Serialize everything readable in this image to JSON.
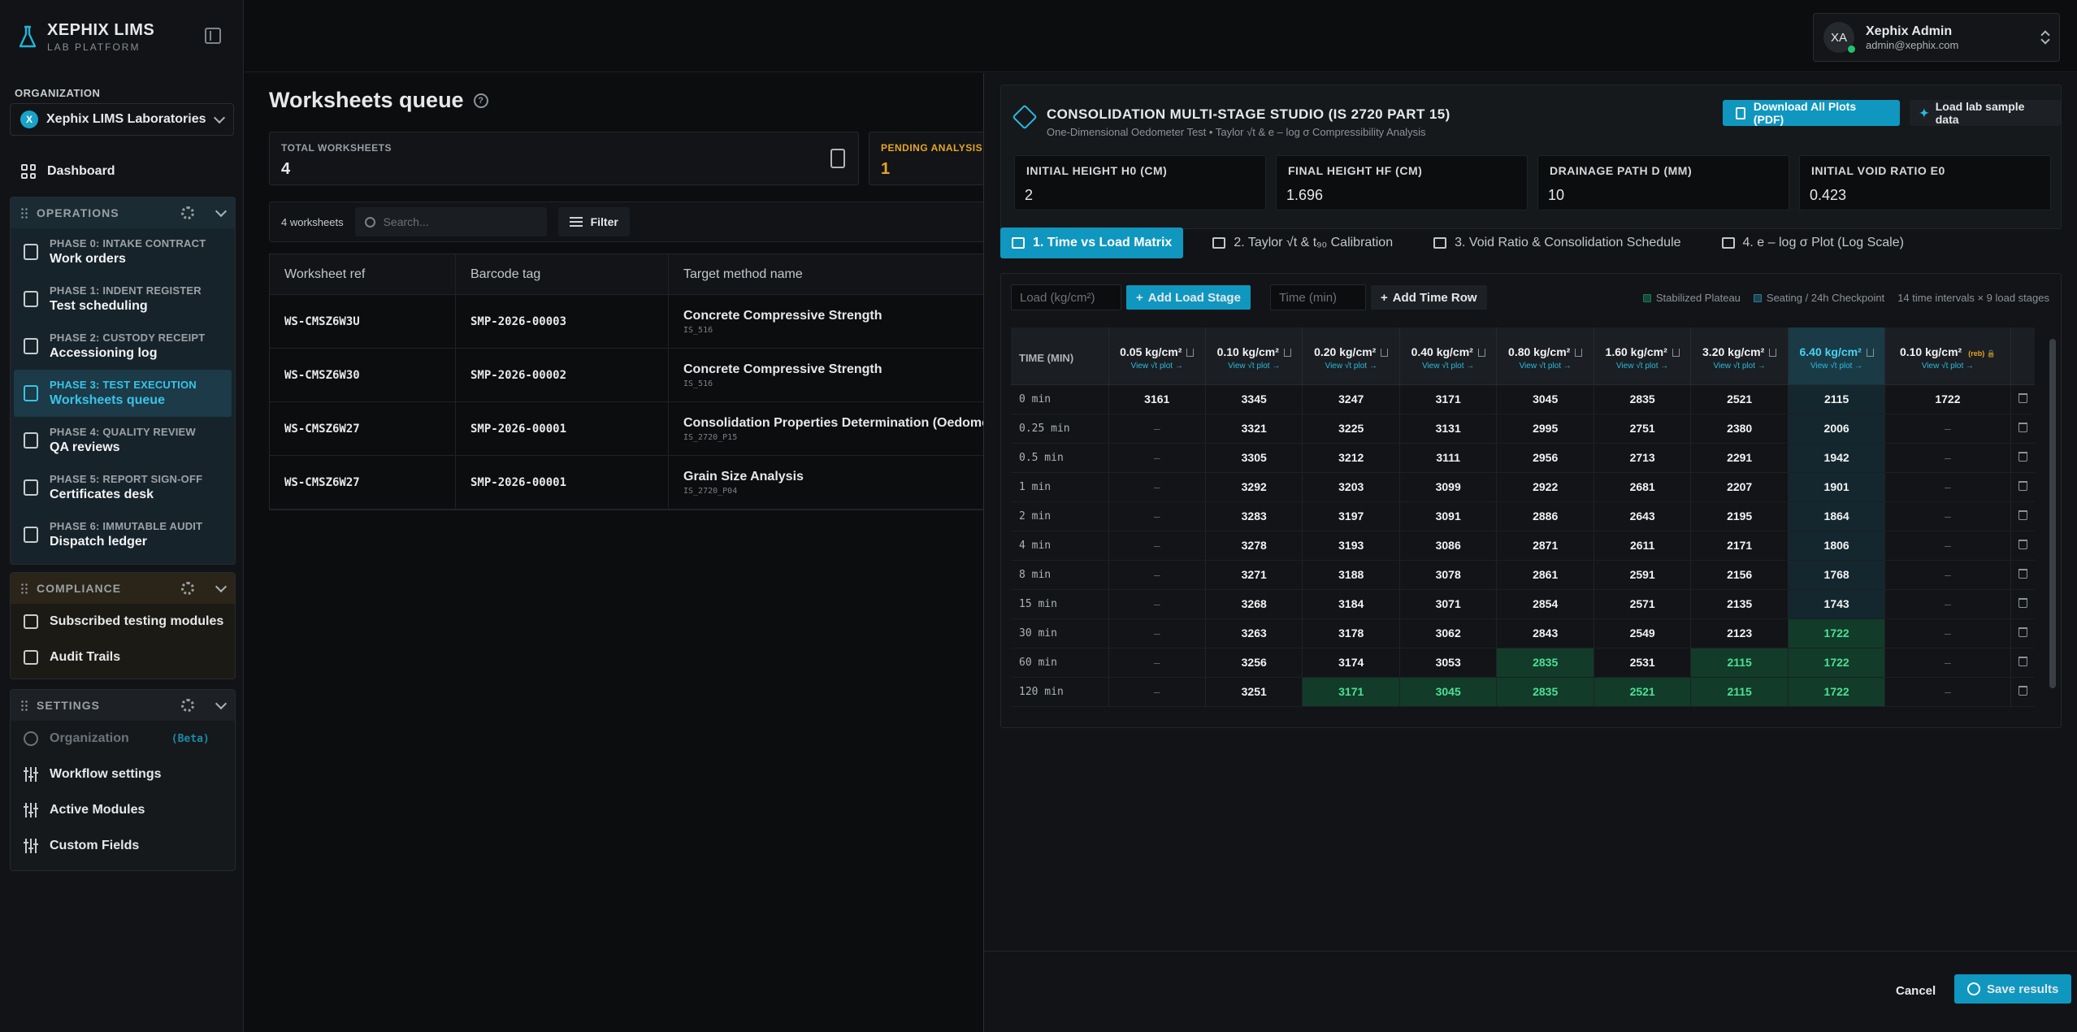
{
  "brand": {
    "title": "XEPHIX LIMS",
    "subtitle": "LAB PLATFORM"
  },
  "organization": {
    "label": "ORGANIZATION",
    "initial": "X",
    "name": "Xephix LIMS Laboratories"
  },
  "nav": {
    "dashboard": "Dashboard",
    "operations": {
      "title": "OPERATIONS",
      "items": [
        {
          "phase": "PHASE 0: INTAKE CONTRACT",
          "label": "Work orders"
        },
        {
          "phase": "PHASE 1: INDENT REGISTER",
          "label": "Test scheduling"
        },
        {
          "phase": "PHASE 2: CUSTODY RECEIPT",
          "label": "Accessioning log"
        },
        {
          "phase": "PHASE 3: TEST EXECUTION",
          "label": "Worksheets queue"
        },
        {
          "phase": "PHASE 4: QUALITY REVIEW",
          "label": "QA reviews"
        },
        {
          "phase": "PHASE 5: REPORT SIGN-OFF",
          "label": "Certificates desk"
        },
        {
          "phase": "PHASE 6: IMMUTABLE AUDIT",
          "label": "Dispatch ledger"
        }
      ]
    },
    "compliance": {
      "title": "COMPLIANCE",
      "items": [
        "Subscribed testing modules",
        "Audit Trails"
      ]
    },
    "settings": {
      "title": "SETTINGS",
      "organization": "Organization",
      "beta": "(Beta)",
      "items": [
        "Workflow settings",
        "Active Modules",
        "Custom Fields"
      ]
    }
  },
  "account": {
    "initials": "XA",
    "name": "Xephix Admin",
    "email": "admin@xephix.com"
  },
  "page": {
    "title": "Worksheets queue",
    "help": "?",
    "stats": [
      {
        "label": "TOTAL WORKSHEETS",
        "value": "4"
      },
      {
        "label": "PENDING ANALYSIS",
        "value": "1"
      }
    ],
    "count": "4 worksheets",
    "search_placeholder": "Search...",
    "filter": "Filter",
    "columns": [
      "Worksheet ref",
      "Barcode tag",
      "Target method name"
    ],
    "rows": [
      {
        "ref": "WS-CMSZ6W3U",
        "barcode": "SMP-2026-00003",
        "method": "Concrete Compressive Strength",
        "code": "IS_516"
      },
      {
        "ref": "WS-CMSZ6W30",
        "barcode": "SMP-2026-00002",
        "method": "Concrete Compressive Strength",
        "code": "IS_516"
      },
      {
        "ref": "WS-CMSZ6W27",
        "barcode": "SMP-2026-00001",
        "method": "Consolidation Properties Determination (Oedometer",
        "code": "IS_2720_P15"
      },
      {
        "ref": "WS-CMSZ6W27",
        "barcode": "SMP-2026-00001",
        "method": "Grain Size Analysis",
        "code": "IS_2720_P04"
      }
    ]
  },
  "studio": {
    "title": "CONSOLIDATION MULTI-STAGE STUDIO (IS 2720 PART 15)",
    "subtitle": "One-Dimensional Oedometer Test • Taylor √t & e – log σ Compressibility Analysis",
    "download": "Download All Plots (PDF)",
    "load_sample": "Load lab sample data",
    "params": [
      {
        "label": "INITIAL HEIGHT H0 (CM)",
        "value": "2"
      },
      {
        "label": "FINAL HEIGHT HF (CM)",
        "value": "1.696"
      },
      {
        "label": "DRAINAGE PATH D (MM)",
        "value": "10"
      },
      {
        "label": "INITIAL VOID RATIO E0",
        "value": "0.423"
      }
    ],
    "tabs": [
      "1. Time vs Load Matrix",
      "2. Taylor √t & t₉₀ Calibration",
      "3. Void Ratio & Consolidation Schedule",
      "4. e – log σ Plot (Log Scale)"
    ],
    "load_placeholder": "Load (kg/cm²)",
    "add_load": "Add Load Stage",
    "time_placeholder": "Time (min)",
    "add_time": "Add Time Row",
    "legend": [
      "Stabilized Plateau",
      "Seating / 24h Checkpoint",
      "14 time intervals × 9 load stages"
    ],
    "colors": {
      "accent": "#0f97bf",
      "stabilized": "#123b2a",
      "selected": "#1a3a46",
      "rebound": "#e6a623"
    }
  },
  "matrix": {
    "time_header": "TIME (MIN)",
    "view_plot": "View √t plot →",
    "rebound_tag": "(reb)",
    "loads": [
      "0.05 kg/cm²",
      "0.10 kg/cm²",
      "0.20 kg/cm²",
      "0.40 kg/cm²",
      "0.80 kg/cm²",
      "1.60 kg/cm²",
      "3.20 kg/cm²",
      "6.40 kg/cm²",
      "0.10 kg/cm²"
    ],
    "selected_stage": 7,
    "rows": [
      {
        "time": "0 min",
        "values": [
          "3161",
          "3345",
          "3247",
          "3171",
          "3045",
          "2835",
          "2521",
          "2115",
          "1722"
        ]
      },
      {
        "time": "0.25 min",
        "values": [
          "–",
          "3321",
          "3225",
          "3131",
          "2995",
          "2751",
          "2380",
          "2006",
          "–"
        ]
      },
      {
        "time": "0.5 min",
        "values": [
          "–",
          "3305",
          "3212",
          "3111",
          "2956",
          "2713",
          "2291",
          "1942",
          "–"
        ]
      },
      {
        "time": "1 min",
        "values": [
          "–",
          "3292",
          "3203",
          "3099",
          "2922",
          "2681",
          "2207",
          "1901",
          "–"
        ]
      },
      {
        "time": "2 min",
        "values": [
          "–",
          "3283",
          "3197",
          "3091",
          "2886",
          "2643",
          "2195",
          "1864",
          "–"
        ]
      },
      {
        "time": "4 min",
        "values": [
          "–",
          "3278",
          "3193",
          "3086",
          "2871",
          "2611",
          "2171",
          "1806",
          "–"
        ]
      },
      {
        "time": "8 min",
        "values": [
          "–",
          "3271",
          "3188",
          "3078",
          "2861",
          "2591",
          "2156",
          "1768",
          "–"
        ]
      },
      {
        "time": "15 min",
        "values": [
          "–",
          "3268",
          "3184",
          "3071",
          "2854",
          "2571",
          "2135",
          "1743",
          "–"
        ]
      },
      {
        "time": "30 min",
        "values": [
          "–",
          "3263",
          "3178",
          "3062",
          "2843",
          "2549",
          "2123",
          "1722",
          "–"
        ]
      },
      {
        "time": "60 min",
        "values": [
          "–",
          "3256",
          "3174",
          "3053",
          "2835",
          "2531",
          "2115",
          "1722",
          "–"
        ]
      },
      {
        "time": "120 min",
        "values": [
          "–",
          "3251",
          "3171",
          "3045",
          "2835",
          "2521",
          "2115",
          "1722",
          "–"
        ]
      }
    ],
    "stabilized": [
      [
        8,
        7
      ],
      [
        9,
        4
      ],
      [
        9,
        6
      ],
      [
        9,
        7
      ],
      [
        10,
        2
      ],
      [
        10,
        3
      ],
      [
        10,
        4
      ],
      [
        10,
        5
      ],
      [
        10,
        6
      ],
      [
        10,
        7
      ]
    ]
  },
  "footer": {
    "cancel": "Cancel",
    "save": "Save results"
  }
}
